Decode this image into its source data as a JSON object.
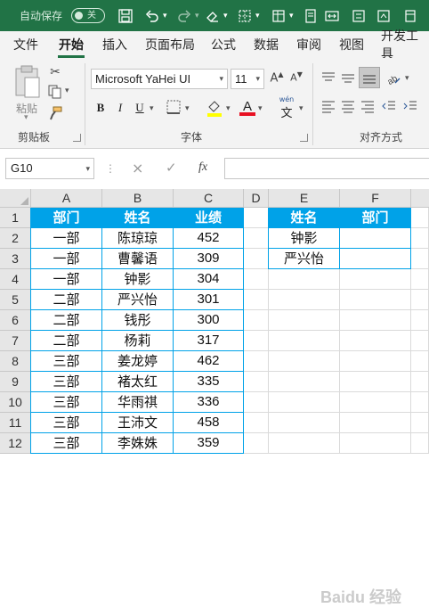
{
  "titlebar": {
    "autosave_label": "自动保存",
    "autosave_state": "关",
    "icons": [
      "save-icon",
      "undo-icon",
      "redo-icon",
      "eraser-icon",
      "borders-icon",
      "table-icon",
      "print-preview-icon",
      "merge-icon",
      "more-icon"
    ]
  },
  "tabs": [
    "文件",
    "开始",
    "插入",
    "页面布局",
    "公式",
    "数据",
    "审阅",
    "视图",
    "开发工具"
  ],
  "active_tab": "开始",
  "ribbon": {
    "clipboard": {
      "paste_label": "粘贴",
      "group_label": "剪贴板"
    },
    "font": {
      "font_name": "Microsoft YaHei UI",
      "font_size": "11",
      "bold": "B",
      "italic": "I",
      "underline": "U",
      "font_color_glyph": "A",
      "phonetic_glyph": "wén",
      "group_label": "字体"
    },
    "alignment": {
      "group_label": "对齐方式"
    }
  },
  "formula_bar": {
    "name_box": "G10",
    "cancel": "×",
    "enter": "✓",
    "fx": "fx",
    "formula": ""
  },
  "grid": {
    "columns": [
      "A",
      "B",
      "C",
      "D",
      "E",
      "F"
    ],
    "rows": [
      "1",
      "2",
      "3",
      "4",
      "5",
      "6",
      "7",
      "8",
      "9",
      "10",
      "11",
      "12"
    ],
    "headers_left": [
      "部门",
      "姓名",
      "业绩"
    ],
    "data_left": [
      [
        "一部",
        "陈琼琼",
        "452"
      ],
      [
        "一部",
        "曹馨语",
        "309"
      ],
      [
        "一部",
        "钟影",
        "304"
      ],
      [
        "二部",
        "严兴怡",
        "301"
      ],
      [
        "二部",
        "钱彤",
        "300"
      ],
      [
        "二部",
        "杨莉",
        "317"
      ],
      [
        "三部",
        "姜龙婷",
        "462"
      ],
      [
        "三部",
        "褚太红",
        "335"
      ],
      [
        "三部",
        "华雨祺",
        "336"
      ],
      [
        "三部",
        "王沛文",
        "458"
      ],
      [
        "三部",
        "李姝姝",
        "359"
      ]
    ],
    "headers_right": [
      "姓名",
      "部门"
    ],
    "data_right": [
      [
        "钟影",
        ""
      ],
      [
        "严兴怡",
        ""
      ]
    ]
  },
  "colors": {
    "title_bar": "#217346",
    "header_fill": "#00a2e8",
    "accent": "#217346"
  }
}
